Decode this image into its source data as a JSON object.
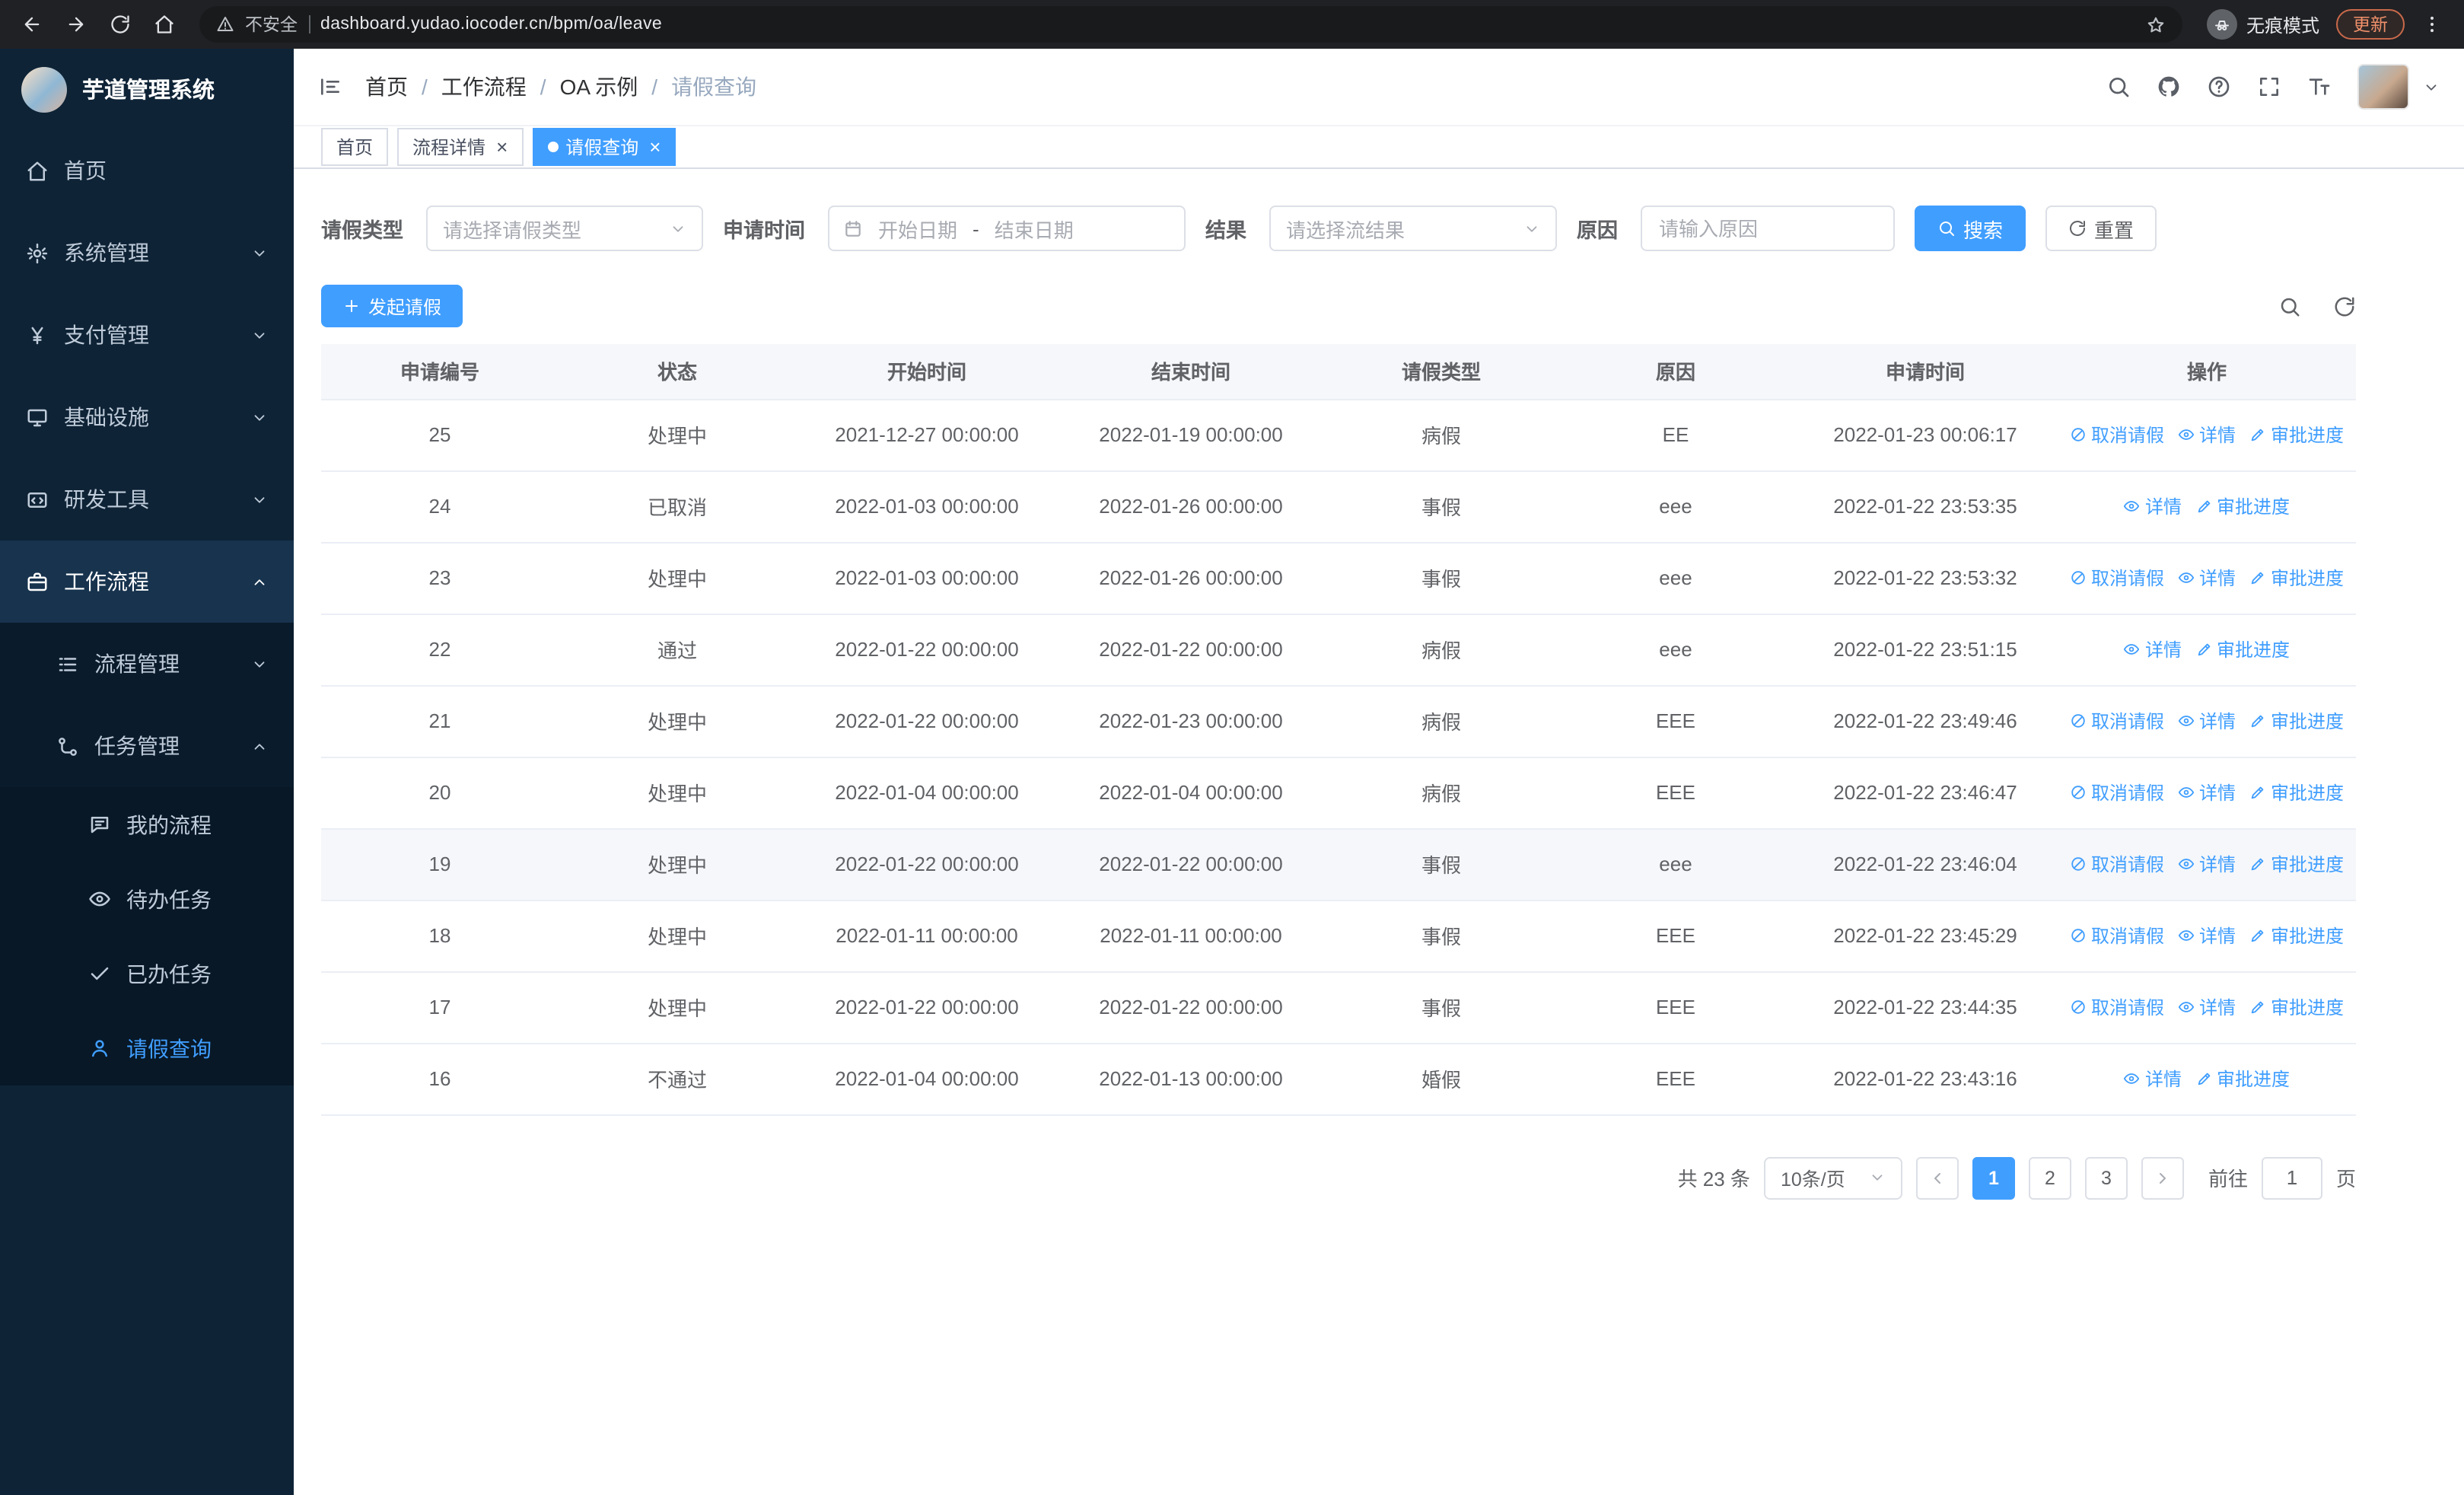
{
  "colors": {
    "accent": "#409eff"
  },
  "browser": {
    "security_label": "不安全",
    "url": "dashboard.yudao.iocoder.cn/bpm/oa/leave",
    "incognito_label": "无痕模式",
    "update_label": "更新"
  },
  "sidebar": {
    "app_title": "芋道管理系统",
    "items": [
      {
        "label": "首页",
        "icon": "home-icon",
        "level": 1
      },
      {
        "label": "系统管理",
        "icon": "gear-icon",
        "level": 1,
        "chevron": "down"
      },
      {
        "label": "支付管理",
        "icon": "yen-icon",
        "level": 1,
        "chevron": "down"
      },
      {
        "label": "基础设施",
        "icon": "infra-icon",
        "level": 1,
        "chevron": "down"
      },
      {
        "label": "研发工具",
        "icon": "tools-icon",
        "level": 1,
        "chevron": "down"
      },
      {
        "label": "工作流程",
        "icon": "workflow-icon",
        "level": 1,
        "chevron": "up",
        "active_parent": true
      },
      {
        "label": "流程管理",
        "icon": "process-icon",
        "level": 2,
        "chevron": "down"
      },
      {
        "label": "任务管理",
        "icon": "task-icon",
        "level": 2,
        "chevron": "up"
      },
      {
        "label": "我的流程",
        "icon": "my-process-icon",
        "level": 3
      },
      {
        "label": "待办任务",
        "icon": "todo-icon",
        "level": 3
      },
      {
        "label": "已办任务",
        "icon": "done-icon",
        "level": 3
      },
      {
        "label": "请假查询",
        "icon": "leave-icon",
        "level": 3,
        "active": true
      }
    ]
  },
  "header": {
    "breadcrumb": [
      "首页",
      "工作流程",
      "OA 示例",
      "请假查询"
    ]
  },
  "tabs": [
    {
      "label": "首页",
      "closable": false,
      "active": false
    },
    {
      "label": "流程详情",
      "closable": true,
      "active": false
    },
    {
      "label": "请假查询",
      "closable": true,
      "active": true
    }
  ],
  "filters": {
    "leave_type_label": "请假类型",
    "leave_type_placeholder": "请选择请假类型",
    "apply_time_label": "申请时间",
    "start_date_placeholder": "开始日期",
    "range_separator": "-",
    "end_date_placeholder": "结束日期",
    "result_label": "结果",
    "result_placeholder": "请选择流结果",
    "reason_label": "原因",
    "reason_placeholder": "请输入原因",
    "search_label": "搜索",
    "reset_label": "重置"
  },
  "toolbar": {
    "create_label": "发起请假"
  },
  "table": {
    "columns": [
      "申请编号",
      "状态",
      "开始时间",
      "结束时间",
      "请假类型",
      "原因",
      "申请时间",
      "操作"
    ],
    "action_labels": {
      "cancel": "取消请假",
      "detail": "详情",
      "progress": "审批进度"
    },
    "rows": [
      {
        "id": "25",
        "status": "处理中",
        "start_time": "2021-12-27 00:00:00",
        "end_time": "2022-01-19 00:00:00",
        "leave_type": "病假",
        "reason": "EE",
        "apply_time": "2022-01-23 00:06:17",
        "actions": [
          "cancel",
          "detail",
          "progress"
        ],
        "highlighted": false
      },
      {
        "id": "24",
        "status": "已取消",
        "start_time": "2022-01-03 00:00:00",
        "end_time": "2022-01-26 00:00:00",
        "leave_type": "事假",
        "reason": "eee",
        "apply_time": "2022-01-22 23:53:35",
        "actions": [
          "detail",
          "progress"
        ],
        "highlighted": false
      },
      {
        "id": "23",
        "status": "处理中",
        "start_time": "2022-01-03 00:00:00",
        "end_time": "2022-01-26 00:00:00",
        "leave_type": "事假",
        "reason": "eee",
        "apply_time": "2022-01-22 23:53:32",
        "actions": [
          "cancel",
          "detail",
          "progress"
        ],
        "highlighted": false
      },
      {
        "id": "22",
        "status": "通过",
        "start_time": "2022-01-22 00:00:00",
        "end_time": "2022-01-22 00:00:00",
        "leave_type": "病假",
        "reason": "eee",
        "apply_time": "2022-01-22 23:51:15",
        "actions": [
          "detail",
          "progress"
        ],
        "highlighted": false
      },
      {
        "id": "21",
        "status": "处理中",
        "start_time": "2022-01-22 00:00:00",
        "end_time": "2022-01-23 00:00:00",
        "leave_type": "病假",
        "reason": "EEE",
        "apply_time": "2022-01-22 23:49:46",
        "actions": [
          "cancel",
          "detail",
          "progress"
        ],
        "highlighted": false
      },
      {
        "id": "20",
        "status": "处理中",
        "start_time": "2022-01-04 00:00:00",
        "end_time": "2022-01-04 00:00:00",
        "leave_type": "病假",
        "reason": "EEE",
        "apply_time": "2022-01-22 23:46:47",
        "actions": [
          "cancel",
          "detail",
          "progress"
        ],
        "highlighted": false
      },
      {
        "id": "19",
        "status": "处理中",
        "start_time": "2022-01-22 00:00:00",
        "end_time": "2022-01-22 00:00:00",
        "leave_type": "事假",
        "reason": "eee",
        "apply_time": "2022-01-22 23:46:04",
        "actions": [
          "cancel",
          "detail",
          "progress"
        ],
        "highlighted": true
      },
      {
        "id": "18",
        "status": "处理中",
        "start_time": "2022-01-11 00:00:00",
        "end_time": "2022-01-11 00:00:00",
        "leave_type": "事假",
        "reason": "EEE",
        "apply_time": "2022-01-22 23:45:29",
        "actions": [
          "cancel",
          "detail",
          "progress"
        ],
        "highlighted": false
      },
      {
        "id": "17",
        "status": "处理中",
        "start_time": "2022-01-22 00:00:00",
        "end_time": "2022-01-22 00:00:00",
        "leave_type": "事假",
        "reason": "EEE",
        "apply_time": "2022-01-22 23:44:35",
        "actions": [
          "cancel",
          "detail",
          "progress"
        ],
        "highlighted": false
      },
      {
        "id": "16",
        "status": "不通过",
        "start_time": "2022-01-04 00:00:00",
        "end_time": "2022-01-13 00:00:00",
        "leave_type": "婚假",
        "reason": "EEE",
        "apply_time": "2022-01-22 23:43:16",
        "actions": [
          "detail",
          "progress"
        ],
        "highlighted": false
      }
    ]
  },
  "pagination": {
    "total_label": "共 23 条",
    "page_size": "10条/页",
    "pages": [
      "1",
      "2",
      "3"
    ],
    "active_page": "1",
    "goto_label": "前往",
    "goto_value": "1",
    "page_unit": "页"
  }
}
